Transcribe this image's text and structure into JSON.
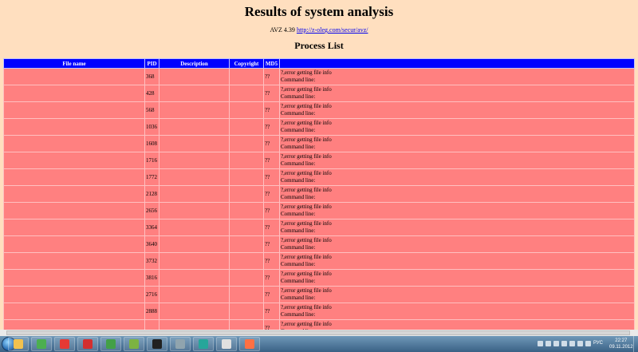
{
  "report": {
    "title": "Results of system analysis",
    "version": "AVZ 4.39",
    "link_text": "http://z-oleg.com/secur/avz/",
    "section_title": "Process List"
  },
  "table": {
    "headers": [
      "File name",
      "PID",
      "Description",
      "Copyright",
      "MD5",
      ""
    ],
    "rows": [
      {
        "file": "",
        "pid": "368",
        "desc": "",
        "copyright": "",
        "md5": "??",
        "info1": "?,error getting file info",
        "info2": "Command line:"
      },
      {
        "file": "",
        "pid": "428",
        "desc": "",
        "copyright": "",
        "md5": "??",
        "info1": "?,error getting file info",
        "info2": "Command line:"
      },
      {
        "file": "",
        "pid": "568",
        "desc": "",
        "copyright": "",
        "md5": "??",
        "info1": "?,error getting file info",
        "info2": "Command line:"
      },
      {
        "file": "",
        "pid": "1036",
        "desc": "",
        "copyright": "",
        "md5": "??",
        "info1": "?,error getting file info",
        "info2": "Command line:"
      },
      {
        "file": "",
        "pid": "1608",
        "desc": "",
        "copyright": "",
        "md5": "??",
        "info1": "?,error getting file info",
        "info2": "Command line:"
      },
      {
        "file": "",
        "pid": "1716",
        "desc": "",
        "copyright": "",
        "md5": "??",
        "info1": "?,error getting file info",
        "info2": "Command line:"
      },
      {
        "file": "",
        "pid": "1772",
        "desc": "",
        "copyright": "",
        "md5": "??",
        "info1": "?,error getting file info",
        "info2": "Command line:"
      },
      {
        "file": "",
        "pid": "2128",
        "desc": "",
        "copyright": "",
        "md5": "??",
        "info1": "?,error getting file info",
        "info2": "Command line:"
      },
      {
        "file": "",
        "pid": "2656",
        "desc": "",
        "copyright": "",
        "md5": "??",
        "info1": "?,error getting file info",
        "info2": "Command line:"
      },
      {
        "file": "",
        "pid": "3364",
        "desc": "",
        "copyright": "",
        "md5": "??",
        "info1": "?,error getting file info",
        "info2": "Command line:"
      },
      {
        "file": "",
        "pid": "3640",
        "desc": "",
        "copyright": "",
        "md5": "??",
        "info1": "?,error getting file info",
        "info2": "Command line:"
      },
      {
        "file": "",
        "pid": "3732",
        "desc": "",
        "copyright": "",
        "md5": "??",
        "info1": "?,error getting file info",
        "info2": "Command line:"
      },
      {
        "file": "",
        "pid": "3816",
        "desc": "",
        "copyright": "",
        "md5": "??",
        "info1": "?,error getting file info",
        "info2": "Command line:"
      },
      {
        "file": "",
        "pid": "2716",
        "desc": "",
        "copyright": "",
        "md5": "??",
        "info1": "?,error getting file info",
        "info2": "Command line:"
      },
      {
        "file": "",
        "pid": "2888",
        "desc": "",
        "copyright": "",
        "md5": "??",
        "info1": "?,error getting file info",
        "info2": "Command line:"
      },
      {
        "file": "",
        "pid": "",
        "desc": "",
        "copyright": "",
        "md5": "??",
        "info1": "?,error getting file info",
        "info2": "Command line:"
      }
    ]
  },
  "taskbar": {
    "apps": [
      {
        "name": "explorer-icon",
        "color": "#f2c14e"
      },
      {
        "name": "chrome-icon",
        "color": "#4caf50"
      },
      {
        "name": "yandex-icon",
        "color": "#e53935"
      },
      {
        "name": "opera-icon",
        "color": "#d32f2f"
      },
      {
        "name": "media-player-icon",
        "color": "#43a047"
      },
      {
        "name": "antivirus-icon",
        "color": "#7cb342"
      },
      {
        "name": "winamp-icon",
        "color": "#212121"
      },
      {
        "name": "network-icon",
        "color": "#90a4ae"
      },
      {
        "name": "earth-icon",
        "color": "#26a69a"
      },
      {
        "name": "window-icon",
        "color": "#e0e0e0"
      },
      {
        "name": "tool-icon",
        "color": "#ff7043"
      }
    ],
    "language": "РУС",
    "time": "22:27",
    "date": "09.11.2012"
  }
}
